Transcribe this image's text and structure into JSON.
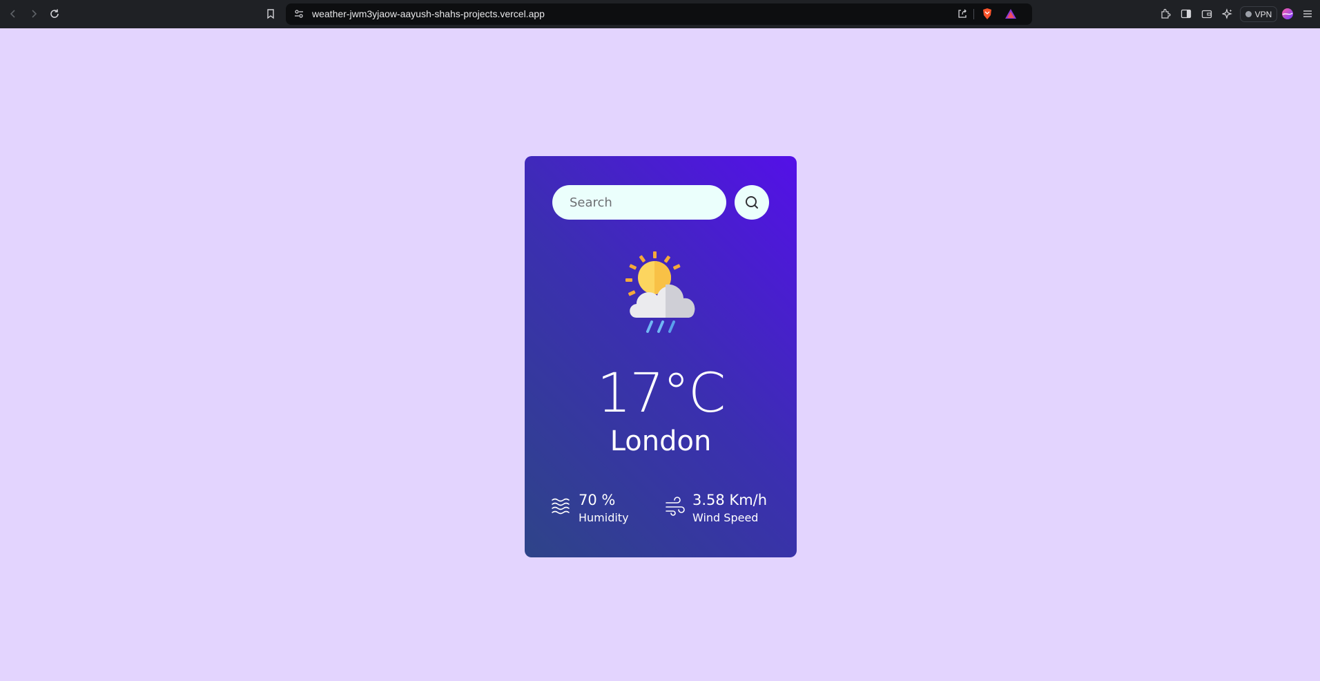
{
  "browser": {
    "url": "weather-jwm3yjaow-aayush-shahs-projects.vercel.app",
    "vpn_label": "VPN"
  },
  "weather": {
    "search_placeholder": "Search",
    "icon": "sun-cloud-rain-icon",
    "temperature": "17°C",
    "city": "London",
    "humidity_value": "70 %",
    "humidity_label": "Humidity",
    "wind_value": "3.58 Km/h",
    "wind_label": "Wind Speed"
  },
  "colors": {
    "page_background": "#e3d4fe",
    "card_gradient_start": "#2e4488",
    "card_gradient_end": "#5410e8",
    "search_background": "#ebfffc"
  }
}
